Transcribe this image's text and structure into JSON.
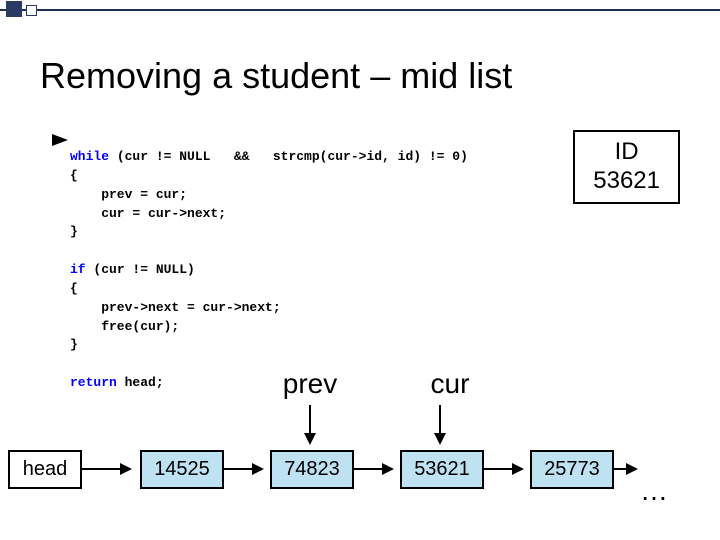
{
  "slide": {
    "title": "Removing a student – mid list",
    "id_box": {
      "label": "ID",
      "value": "53621"
    },
    "code": {
      "l1a": "while",
      "l1b": " (cur != NULL   &&   strcmp(cur->id, id) != ",
      "l1c": "0",
      "l1d": ")",
      "l2": "{",
      "l3": "    prev = cur;",
      "l4": "    cur = cur->next;",
      "l5": "}",
      "l6": "",
      "l7a": "if",
      "l7b": " (cur != NULL)",
      "l8": "{",
      "l9": "    prev->next = cur->next;",
      "l10": "    free(cur);",
      "l11": "}",
      "l12": "",
      "l13a": "return",
      "l13b": " head;"
    },
    "labels": {
      "prev": "prev",
      "cur": "cur"
    },
    "head_label": "head",
    "nodes": [
      "14525",
      "74823",
      "53621",
      "25773"
    ],
    "ellipsis": "…"
  }
}
